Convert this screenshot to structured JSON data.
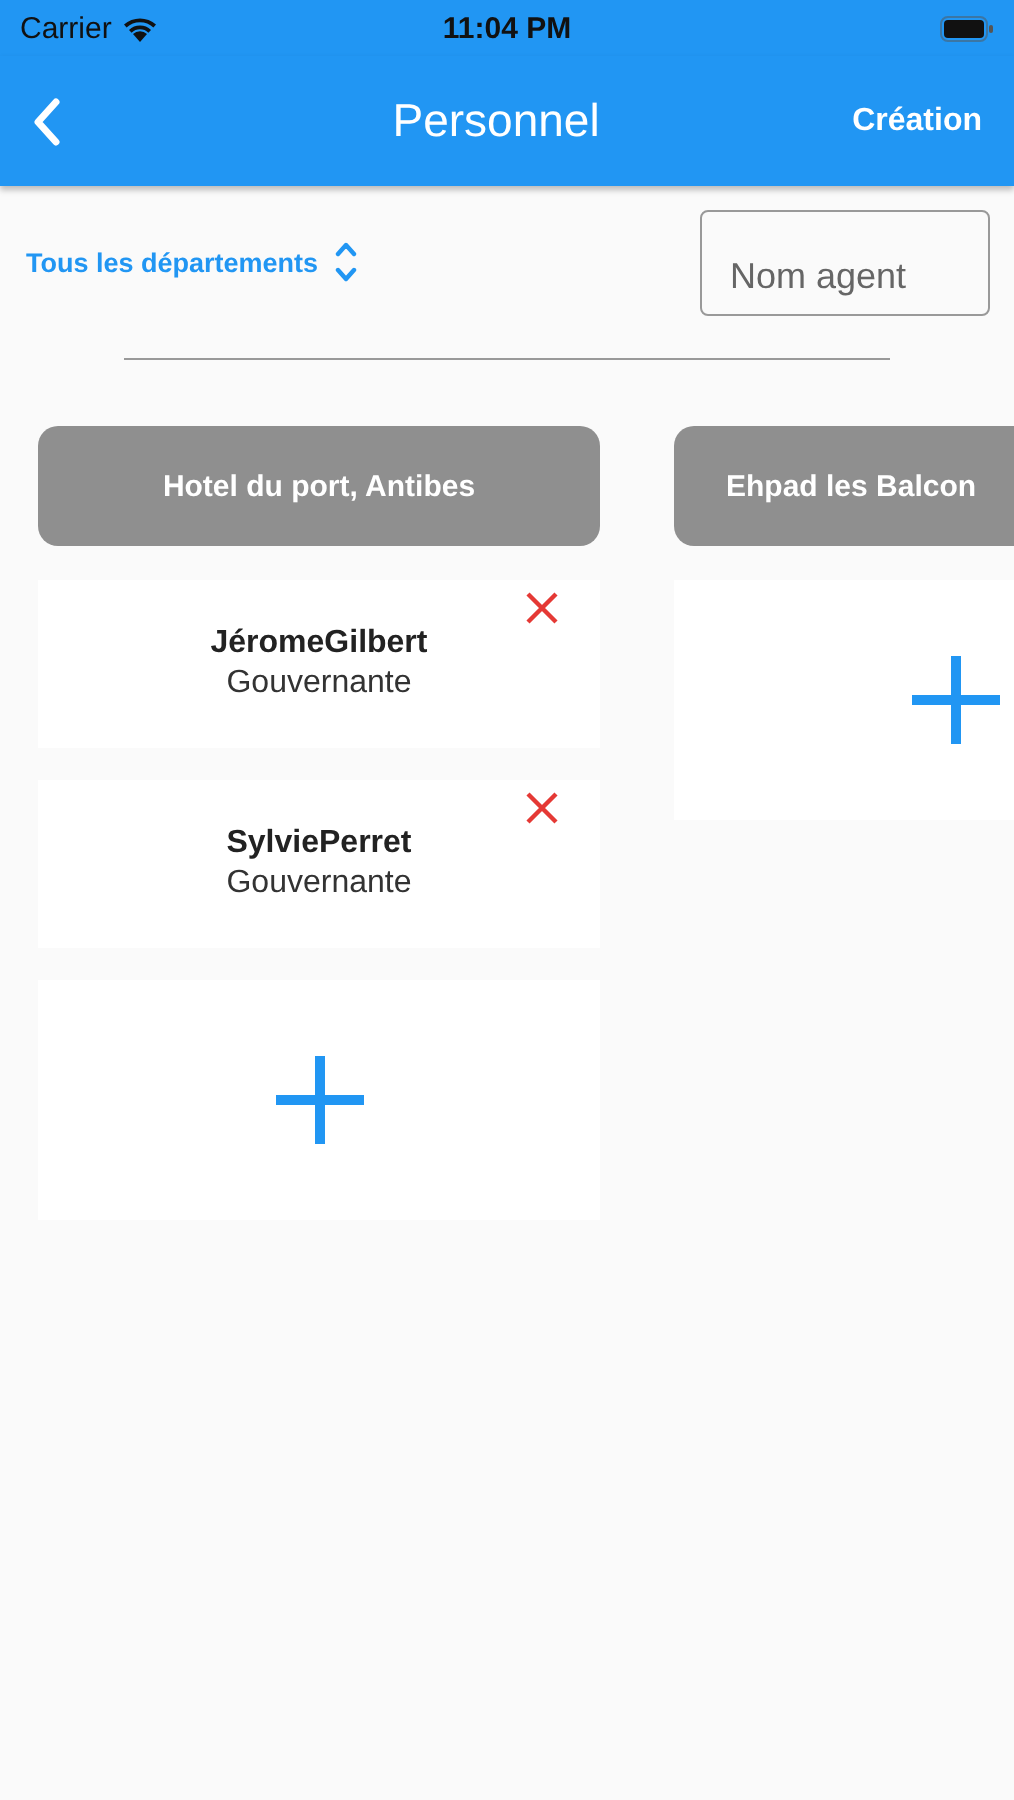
{
  "status_bar": {
    "carrier": "Carrier",
    "time": "11:04 PM"
  },
  "nav": {
    "title": "Personnel",
    "action": "Création"
  },
  "filter": {
    "department": "Tous les départements",
    "search_placeholder": "Nom agent"
  },
  "columns": [
    {
      "title": "Hotel du port, Antibes",
      "cards": [
        {
          "name": "JéromeGilbert",
          "role": "Gouvernante"
        },
        {
          "name": "SylviePerret",
          "role": "Gouvernante"
        }
      ]
    },
    {
      "title": "Ehpad les Balcon"
    }
  ]
}
